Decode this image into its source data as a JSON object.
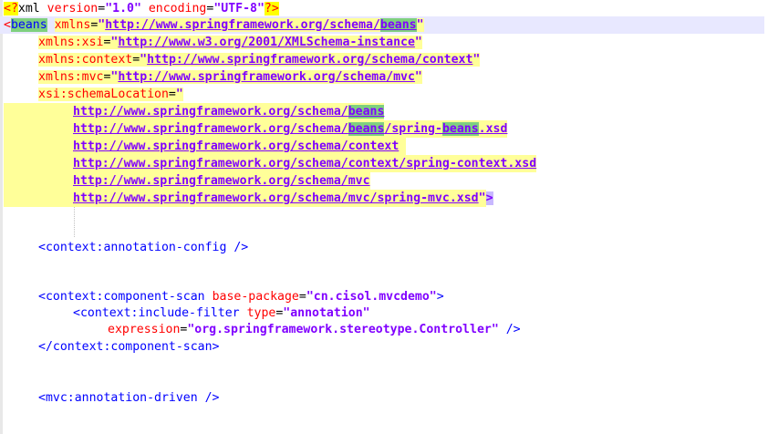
{
  "lines": [
    {
      "prolog_open": "<?",
      "prolog_name": "xml",
      "v_attr": "version",
      "v_eq": "=",
      "v_val": "\"1.0\"",
      "e_attr": "encoding",
      "e_eq": "=",
      "e_val": "\"UTF-8\"",
      "prolog_close": "?>"
    },
    {
      "open": "<",
      "tag": "beans",
      "attr": "xmlns",
      "eq": "=",
      "q1": "\"",
      "url_pre": "http://www.springframework.org/schema/",
      "url_match": "beans",
      "q2": "\""
    },
    {
      "attr": "xmlns:xsi",
      "eq": "=",
      "q1": "\"",
      "url": "http://www.w3.org/2001/XMLSchema-instance",
      "q2": "\""
    },
    {
      "attr": "xmlns:context",
      "eq": "=",
      "q1": "\"",
      "url": "http://www.springframework.org/schema/context",
      "q2": "\""
    },
    {
      "attr": "xmlns:mvc",
      "eq": "=",
      "q1": "\"",
      "url": "http://www.springframework.org/schema/mvc",
      "q2": "\""
    },
    {
      "attr": "xsi:schemaLocation",
      "eq": "=",
      "q1": "\""
    },
    {
      "url_pre": "http://www.springframework.org/schema/",
      "url_match": "beans"
    },
    {
      "url_pre": "http://www.springframework.org/schema/",
      "url_match": "beans",
      "url_mid": "/spring-",
      "url_match2": "beans",
      "url_post": ".xsd"
    },
    {
      "url": "http://www.springframework.org/schema/context"
    },
    {
      "url": "http://www.springframework.org/schema/context/spring-context.xsd"
    },
    {
      "url": "http://www.springframework.org/schema/mvc"
    },
    {
      "url": "http://www.springframework.org/schema/mvc/spring-mvc.xsd",
      "q2": "\"",
      "close": ">"
    },
    {
      "text": "<context:annotation-config />"
    },
    {
      "open": "<context:component-scan",
      "attr": "base-package",
      "eq": "=",
      "val": "\"cn.cisol.mvcdemo\"",
      "close": ">"
    },
    {
      "open": "<context:include-filter",
      "attr": "type",
      "eq": "=",
      "val": "\"annotation\""
    },
    {
      "attr": "expression",
      "eq": "=",
      "val": "\"org.springframework.stereotype.Controller\"",
      "close": "/>"
    },
    {
      "text": "</context:component-scan>"
    },
    {
      "text": "<mvc:annotation-driven />"
    }
  ]
}
